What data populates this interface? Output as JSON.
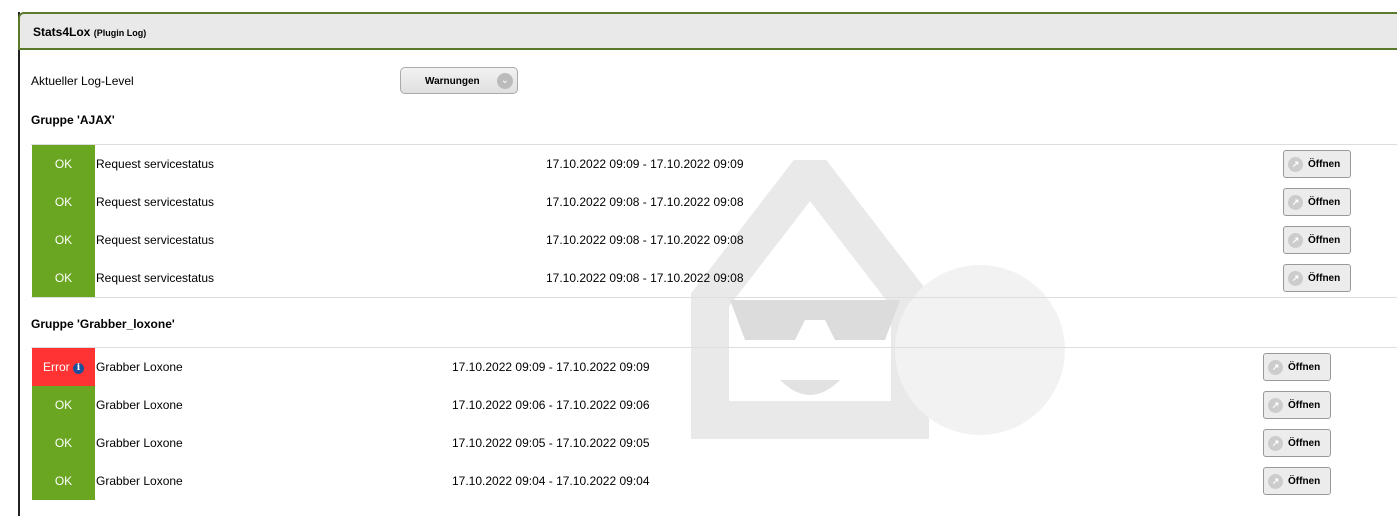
{
  "header": {
    "title": "Stats4Lox",
    "subtitle": "(Plugin Log)"
  },
  "loglevel": {
    "label": "Aktueller Log-Level",
    "value": "Warnungen"
  },
  "groups": [
    {
      "title": "Gruppe 'AJAX'",
      "rows": [
        {
          "status": "OK",
          "name": "Request servicestatus",
          "time": "17.10.2022 09:09 - 17.10.2022 09:09",
          "button": "Öffnen"
        },
        {
          "status": "OK",
          "name": "Request servicestatus",
          "time": "17.10.2022 09:08 - 17.10.2022 09:08",
          "button": "Öffnen"
        },
        {
          "status": "OK",
          "name": "Request servicestatus",
          "time": "17.10.2022 09:08 - 17.10.2022 09:08",
          "button": "Öffnen"
        },
        {
          "status": "OK",
          "name": "Request servicestatus",
          "time": "17.10.2022 09:08 - 17.10.2022 09:08",
          "button": "Öffnen"
        }
      ]
    },
    {
      "title": "Gruppe 'Grabber_loxone'",
      "rows": [
        {
          "status": "Error",
          "name": "Grabber Loxone",
          "time": "17.10.2022 09:09 - 17.10.2022 09:09",
          "button": "Öffnen"
        },
        {
          "status": "OK",
          "name": "Grabber Loxone",
          "time": "17.10.2022 09:06 - 17.10.2022 09:06",
          "button": "Öffnen"
        },
        {
          "status": "OK",
          "name": "Grabber Loxone",
          "time": "17.10.2022 09:05 - 17.10.2022 09:05",
          "button": "Öffnen"
        },
        {
          "status": "OK",
          "name": "Grabber Loxone",
          "time": "17.10.2022 09:04 - 17.10.2022 09:04",
          "button": "Öffnen"
        }
      ]
    }
  ],
  "colors": {
    "ok": "#6aa621",
    "error": "#ff3333",
    "border": "#5a7a2a"
  }
}
